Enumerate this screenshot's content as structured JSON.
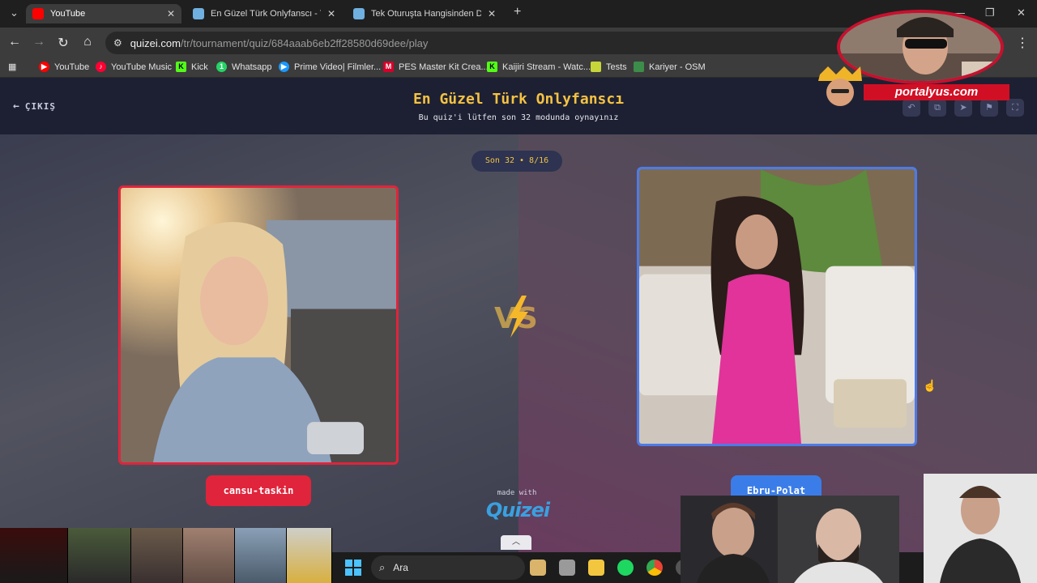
{
  "browser": {
    "tabs": [
      {
        "title": "YouTube",
        "favicon_color": "#ff0000",
        "active": true
      },
      {
        "title": "En Güzel Türk Onlyfanscı - Tier",
        "favicon_color": "#6fb0e0",
        "active": false
      },
      {
        "title": "Tek Oturuşta Hangisinden Daha",
        "favicon_color": "#6fb0e0",
        "active": false
      }
    ],
    "new_tab": "+",
    "url_host": "quizei.com",
    "url_path": "/tr/tournament/quiz/684aaab6eb2ff28580d69dee/play",
    "bookmarks": [
      {
        "label": "YouTube",
        "icon": "youtube-icon",
        "color": "#ff0000"
      },
      {
        "label": "YouTube Music",
        "icon": "youtube-music-icon",
        "color": "#ff0033"
      },
      {
        "label": "Kick",
        "icon": "kick-icon",
        "color": "#53fc18"
      },
      {
        "label": "Whatsapp",
        "icon": "whatsapp-icon",
        "color": "#25d366"
      },
      {
        "label": "Prime Video| Filmler...",
        "icon": "prime-video-icon",
        "color": "#1a98ff"
      },
      {
        "label": "PES Master Kit Crea...",
        "icon": "pes-master-icon",
        "color": "#d6002a"
      },
      {
        "label": "Kaijiri Stream - Watc...",
        "icon": "kick-icon",
        "color": "#53fc18"
      },
      {
        "label": "Tests",
        "icon": "tests-icon",
        "color": "#c6d63a"
      },
      {
        "label": "Kariyer - OSM",
        "icon": "osm-icon",
        "color": "#3c8c4a"
      }
    ]
  },
  "quiz": {
    "exit_label": "ÇIKIŞ",
    "title": "En Güzel Türk Onlyfanscı",
    "subtitle": "Bu quiz'i lütfen son 32 modunda oynayınız",
    "round": "Son 32 • 8/16",
    "left": {
      "name": "cansu-taskin",
      "accent": "#e0243b"
    },
    "right": {
      "name": "Ebru-Polat",
      "accent": "#3b7de8"
    },
    "vs_label": "VS",
    "made_with": "made with",
    "brand": "Quizei",
    "accent_title": "#f5c242"
  },
  "overlay": {
    "brand_text": "portalyus.com",
    "search_label": "Ara"
  }
}
